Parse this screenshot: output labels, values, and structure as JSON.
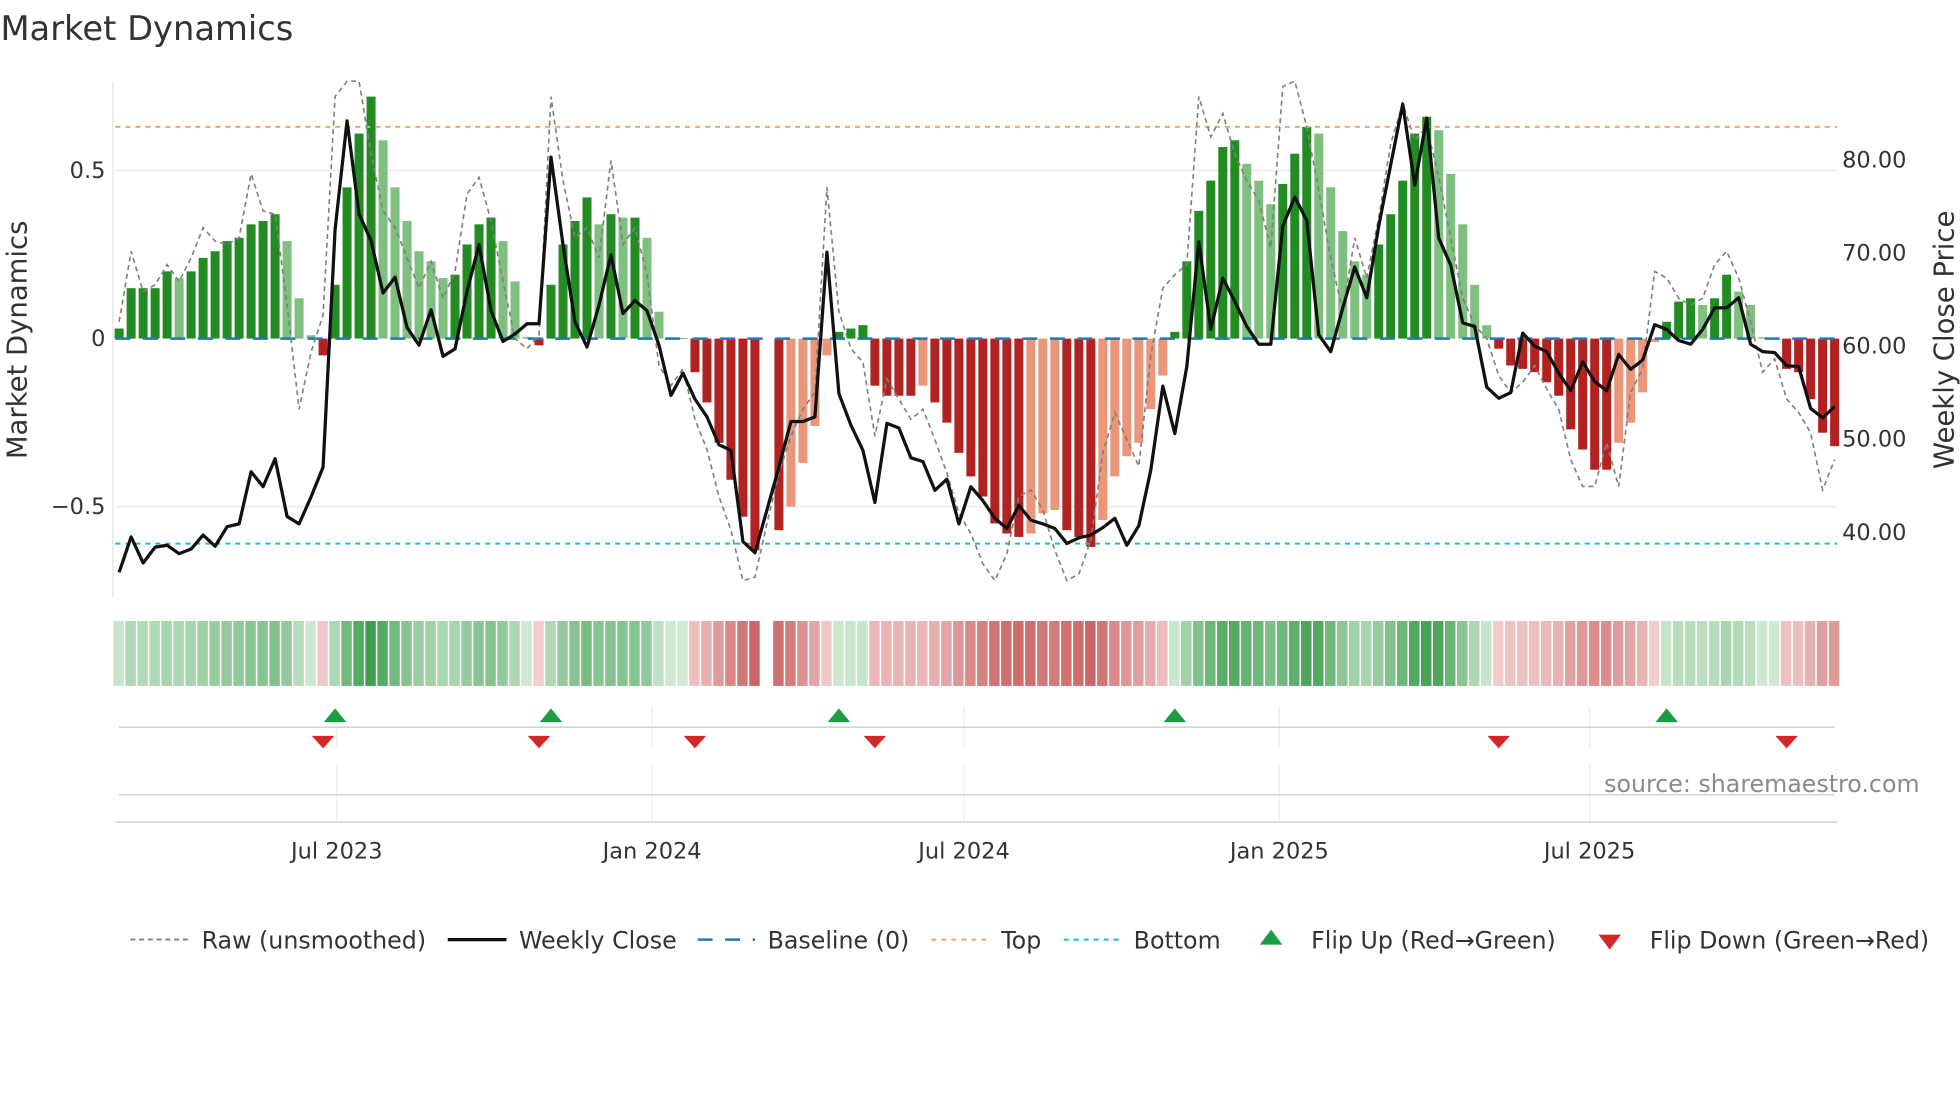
{
  "chart_data": {
    "type": "bar",
    "title": "Market Dynamics",
    "ylabel": "Market Dynamics",
    "ylabel_right": "Weekly Close Price",
    "xlabel": "",
    "start_week": "2023-02-24",
    "frequency": "weekly",
    "ylim": [
      -0.78,
      0.76
    ],
    "ylim_right": [
      32.5,
      86.5
    ],
    "top_level": 0.63,
    "bottom_level": -0.61,
    "baseline": 0,
    "grid": true,
    "legend_position": "bottom",
    "y_ticks_left": [
      {
        "value": 0.5,
        "label": "0.5"
      },
      {
        "value": 0,
        "label": "0"
      },
      {
        "value": -0.5,
        "label": "−0.5"
      }
    ],
    "y_ticks_right": [
      {
        "value": 80,
        "label": "80.00"
      },
      {
        "value": 70,
        "label": "70.00"
      },
      {
        "value": 60,
        "label": "60.00"
      },
      {
        "value": 50,
        "label": "50.00"
      },
      {
        "value": 40,
        "label": "40.00"
      }
    ],
    "x_ticks": [
      {
        "date": "2023-07-01",
        "label": "Jul 2023"
      },
      {
        "date": "2024-01-01",
        "label": "Jan 2024"
      },
      {
        "date": "2024-07-01",
        "label": "Jul 2024"
      },
      {
        "date": "2025-01-01",
        "label": "Jan 2025"
      },
      {
        "date": "2025-07-01",
        "label": "Jul 2025"
      }
    ],
    "series": [
      {
        "name": "Market Dynamics (smoothed)",
        "type": "bar",
        "values": [
          0.03,
          0.15,
          0.15,
          0.15,
          0.2,
          0.18,
          0.2,
          0.24,
          0.26,
          0.29,
          0.3,
          0.34,
          0.35,
          0.37,
          0.29,
          0.12,
          0.01,
          -0.05,
          0.16,
          0.45,
          0.61,
          0.72,
          0.59,
          0.45,
          0.35,
          0.26,
          0.23,
          0.18,
          0.19,
          0.28,
          0.34,
          0.36,
          0.29,
          0.17,
          0.005,
          -0.02,
          0.16,
          0.28,
          0.35,
          0.42,
          0.34,
          0.37,
          0.36,
          0.36,
          0.3,
          0.08,
          0.004,
          0.002,
          -0.1,
          -0.19,
          -0.31,
          -0.42,
          -0.53,
          -0.63,
          null,
          -0.57,
          -0.5,
          -0.37,
          -0.26,
          -0.05,
          0.02,
          0.03,
          0.04,
          -0.14,
          -0.17,
          -0.17,
          -0.17,
          -0.14,
          -0.19,
          -0.25,
          -0.34,
          -0.41,
          -0.47,
          -0.55,
          -0.58,
          -0.59,
          -0.58,
          -0.52,
          -0.51,
          -0.57,
          -0.59,
          -0.62,
          -0.54,
          -0.41,
          -0.35,
          -0.31,
          -0.21,
          -0.11,
          0.02,
          0.23,
          0.38,
          0.47,
          0.57,
          0.59,
          0.52,
          0.47,
          0.4,
          0.46,
          0.55,
          0.63,
          0.61,
          0.45,
          0.32,
          0.23,
          0.19,
          0.28,
          0.37,
          0.47,
          0.61,
          0.66,
          0.62,
          0.49,
          0.34,
          0.16,
          0.04,
          -0.03,
          -0.08,
          -0.09,
          -0.1,
          -0.13,
          -0.17,
          -0.27,
          -0.33,
          -0.39,
          -0.39,
          -0.31,
          -0.25,
          -0.16,
          -0.01,
          0.05,
          0.11,
          0.12,
          0.1,
          0.12,
          0.19,
          0.14,
          0.1,
          0.004,
          0.002,
          -0.09,
          -0.1,
          -0.18,
          -0.28,
          -0.32
        ]
      },
      {
        "name": "Raw (unsmoothed)",
        "type": "line",
        "values": [
          0.05,
          0.26,
          0.14,
          0.16,
          0.22,
          0.17,
          0.24,
          0.33,
          0.29,
          0.28,
          0.3,
          0.49,
          0.38,
          0.37,
          0.1,
          -0.21,
          -0.04,
          0.07,
          0.72,
          0.79,
          0.77,
          0.55,
          0.38,
          0.33,
          0.24,
          0.15,
          0.23,
          0.12,
          0.2,
          0.43,
          0.48,
          0.35,
          0.17,
          0.0,
          -0.03,
          0.01,
          0.72,
          0.47,
          0.3,
          0.33,
          0.24,
          0.53,
          0.28,
          0.33,
          0.19,
          -0.08,
          -0.14,
          -0.09,
          -0.24,
          -0.33,
          -0.47,
          -0.57,
          -0.72,
          -0.71,
          -0.55,
          -0.4,
          -0.29,
          -0.21,
          -0.16,
          0.45,
          0.08,
          -0.03,
          -0.07,
          -0.29,
          -0.12,
          -0.18,
          -0.24,
          -0.21,
          -0.3,
          -0.4,
          -0.52,
          -0.58,
          -0.67,
          -0.72,
          -0.64,
          -0.47,
          -0.45,
          -0.51,
          -0.63,
          -0.72,
          -0.7,
          -0.6,
          -0.34,
          -0.22,
          -0.3,
          -0.38,
          -0.05,
          0.15,
          0.19,
          0.22,
          0.72,
          0.6,
          0.67,
          0.55,
          0.47,
          0.41,
          0.27,
          0.75,
          0.78,
          0.63,
          0.44,
          0.24,
          0.08,
          0.3,
          0.18,
          0.36,
          0.58,
          0.7,
          0.59,
          0.63,
          0.48,
          0.3,
          0.12,
          0.04,
          0.0,
          -0.11,
          -0.16,
          -0.13,
          -0.08,
          -0.15,
          -0.21,
          -0.36,
          -0.44,
          -0.44,
          -0.31,
          -0.44,
          -0.16,
          -0.09,
          0.2,
          0.18,
          0.12,
          0.1,
          0.12,
          0.22,
          0.26,
          0.18,
          0.05,
          -0.1,
          -0.06,
          -0.18,
          -0.22,
          -0.28,
          -0.45,
          -0.36
        ]
      },
      {
        "name": "Weekly Close",
        "type": "line",
        "axis": "right",
        "values": [
          35.7,
          39.5,
          36.7,
          38.4,
          38.6,
          37.7,
          38.2,
          39.7,
          38.5,
          40.6,
          40.9,
          46.5,
          44.9,
          47.9,
          41.7,
          40.9,
          43.8,
          47.0,
          72.5,
          84.2,
          74.2,
          71.3,
          65.7,
          67.4,
          62.0,
          60.1,
          63.9,
          58.9,
          59.7,
          65.9,
          70.9,
          63.8,
          60.5,
          61.3,
          62.4,
          62.4,
          80.3,
          70.9,
          62.6,
          59.9,
          64.4,
          69.8,
          63.5,
          64.9,
          63.8,
          60.1,
          54.7,
          57.1,
          54.3,
          52.4,
          49.4,
          48.8,
          39.0,
          37.8,
          42.4,
          47.0,
          51.9,
          51.9,
          52.4,
          70.1,
          54.9,
          51.5,
          48.8,
          43.2,
          51.7,
          51.2,
          48.0,
          47.6,
          44.5,
          45.7,
          40.9,
          44.9,
          43.4,
          41.5,
          40.4,
          42.9,
          41.3,
          40.9,
          40.4,
          38.8,
          39.4,
          39.7,
          40.5,
          41.5,
          38.6,
          40.7,
          46.7,
          55.7,
          50.6,
          57.8,
          71.2,
          61.8,
          67.3,
          64.8,
          62.1,
          60.2,
          60.2,
          72.9,
          76.0,
          73.5,
          61.2,
          59.4,
          64.1,
          68.5,
          65.2,
          72.9,
          79.5,
          86.0,
          77.3,
          84.5,
          71.6,
          68.7,
          62.5,
          62.1,
          55.6,
          54.4,
          55.0,
          61.4,
          60.0,
          59.4,
          57.1,
          55.2,
          58.3,
          56.2,
          55.2,
          59.1,
          57.5,
          58.5,
          62.3,
          61.8,
          60.6,
          60.2,
          61.8,
          64.1,
          64.1,
          65.2,
          60.2,
          59.4,
          59.3,
          57.9,
          57.8,
          53.3,
          52.3,
          53.5
        ]
      }
    ],
    "legend": [
      {
        "key": "raw",
        "label": "Raw (unsmoothed)"
      },
      {
        "key": "close",
        "label": "Weekly Close"
      },
      {
        "key": "baseline",
        "label": "Baseline (0)"
      },
      {
        "key": "top",
        "label": "Top"
      },
      {
        "key": "bottom",
        "label": "Bottom"
      },
      {
        "key": "flip_up",
        "label": "Flip Up (Red→Green)"
      },
      {
        "key": "flip_down",
        "label": "Flip Down (Green→Red)"
      }
    ],
    "colors": {
      "pos_rising": "#228b22",
      "pos_falling": "#7fbf7f",
      "neg_falling": "#b22222",
      "neg_rising": "#e9967a",
      "raw": "#808080",
      "close": "#111111",
      "baseline": "#1f77b4",
      "top": "#f0a868",
      "bottom": "#17becf",
      "flip_up": "#1a9e44",
      "flip_down": "#d62728"
    }
  },
  "source_text": "source: sharemaestro.com"
}
